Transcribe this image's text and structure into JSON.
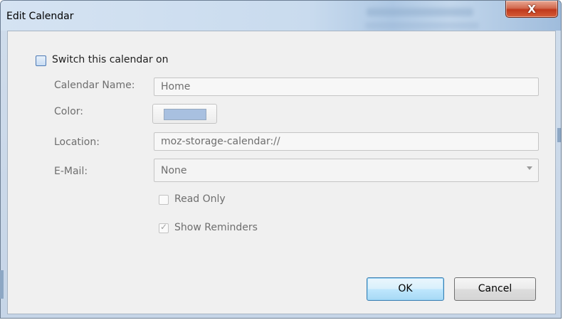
{
  "window": {
    "title": "Edit Calendar",
    "close_glyph": "X"
  },
  "switch": {
    "label": "Switch this calendar on",
    "checked": false
  },
  "form": {
    "name_label": "Calendar Name:",
    "name_value": "Home",
    "color_label": "Color:",
    "color_value": "#a8c0e0",
    "location_label": "Location:",
    "location_value": "moz-storage-calendar://",
    "email_label": "E-Mail:",
    "email_value": "None"
  },
  "options": {
    "read_only_label": "Read Only",
    "read_only_checked": false,
    "reminders_label": "Show Reminders",
    "reminders_checked": true,
    "check_glyph": "✓"
  },
  "buttons": {
    "ok_label": "OK",
    "cancel_label": "Cancel"
  }
}
